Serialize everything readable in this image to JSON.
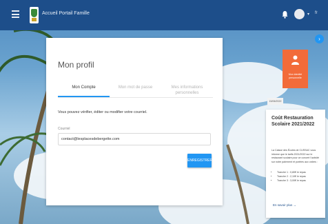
{
  "header": {
    "app_title": "Accueil Portail Famille",
    "lang": "fr",
    "icons": {
      "menu": "menu-icon",
      "bell": "bell-icon",
      "avatar": "avatar",
      "dropdown": "chevron-down-icon"
    }
  },
  "profile_card": {
    "title": "Mon profil",
    "tabs": [
      {
        "label": "Mon Compte",
        "active": true
      },
      {
        "label": "Mon mot de passe",
        "active": false
      },
      {
        "label": "Mes informations personnelles",
        "active": false
      }
    ],
    "info_text": "Vous pouvez vérifier, éditer ou modifier votre courriel.",
    "email_label": "Courriel",
    "email_value": "contact@lesplacesdebergette.com",
    "save_label": "ENREGISTRER"
  },
  "side": {
    "orange_tile_label": "Mon identité personnelle",
    "tag": "15/06/2022"
  },
  "news": {
    "title": "Coût Restauration Scolaire 2021/2022",
    "body": "La Caisse des Écoles de CUSSAC vous informe que le tarifs 2021/2022 sur le restaurant scolaire pour ce concert l'activité sur notre paiement et portées aux ordres :",
    "items": [
      "Tranche 1 : 0,80€ le repas",
      "Tranche 2 : 2,10€ le repas",
      "Tranche 3 : 3,00€ le repas"
    ],
    "read_more": "En savoir plus →"
  },
  "colors": {
    "topbar": "#1d4e8a",
    "accent": "#2196f3",
    "orange": "#f26b3a"
  }
}
